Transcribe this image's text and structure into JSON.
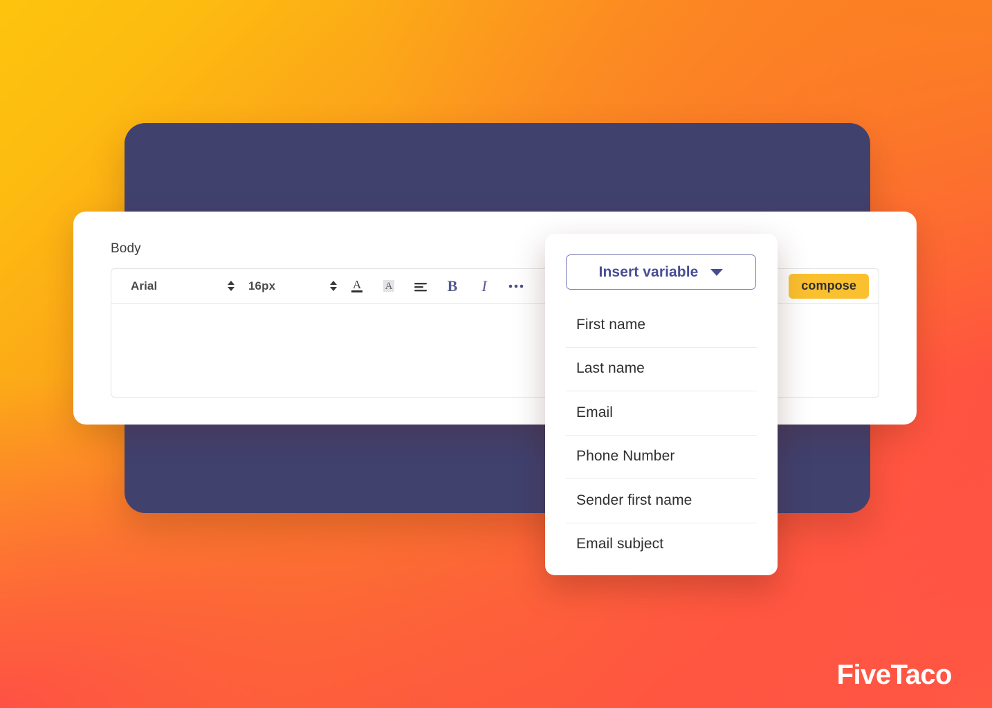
{
  "background": {
    "gradient_from": "#FDC40D",
    "gradient_mid": "#FB7F28",
    "gradient_to": "#FF4B46",
    "panel_color": "#41416E"
  },
  "editor": {
    "field_label": "Body",
    "toolbar": {
      "font_family": "Arial",
      "font_size": "16px",
      "buttons": [
        {
          "name": "text-color-icon",
          "title": "Text color"
        },
        {
          "name": "highlight-color-icon",
          "title": "Highlight color"
        },
        {
          "name": "align-left-icon",
          "title": "Align"
        },
        {
          "name": "bold-icon",
          "title": "Bold"
        },
        {
          "name": "italic-icon",
          "title": "Italic"
        },
        {
          "name": "more-options-icon",
          "title": "More"
        }
      ],
      "compose_label": "compose",
      "compose_color": "#FBC02F"
    },
    "content": ""
  },
  "dropdown": {
    "trigger_label": "Insert variable",
    "trigger_color": "#494C94",
    "trigger_border": "#7E7FB4",
    "caret_icon": "chevron-down-icon",
    "items": [
      {
        "label": "First name"
      },
      {
        "label": "Last name"
      },
      {
        "label": "Email"
      },
      {
        "label": "Phone Number"
      },
      {
        "label": "Sender first name"
      },
      {
        "label": "Email subject"
      }
    ]
  },
  "watermark": {
    "brand": "FiveTaco",
    "color": "#FFFFFF"
  }
}
